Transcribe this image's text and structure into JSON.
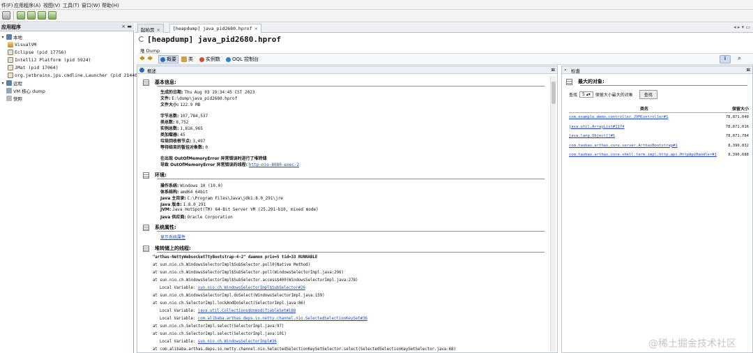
{
  "menu": {
    "items": [
      "件(F)",
      "应用程序(A)",
      "视图(V)",
      "工具(T)",
      "窗口(W)",
      "帮助(H)"
    ]
  },
  "left_panel": {
    "title": "应用程序",
    "controls": "× ▬",
    "tree": {
      "local": "本地",
      "apps": [
        "VisualVM",
        "Eclipse (pid 17756)",
        "IntelliJ Platform (pid 5924)",
        "JMat (pid 17064)",
        "org.jetbrains.jps.cmdline.Launcher (pid 21440)"
      ],
      "remote": "远程",
      "vm_dump": "VM 核心 dump",
      "snapshots": "快照"
    }
  },
  "tabs": {
    "start_page": "起始页",
    "heapdump": "[heapdump] java_pid2680.hprof",
    "right_controls": "◂ ▸ ▾ ▭"
  },
  "document": {
    "title": "[heapdump] java_pid2680.hprof",
    "subtab": "堆 Dump"
  },
  "navbar": {
    "summary": "概要",
    "classes": "类",
    "instances": "实例数",
    "oql": "OQL 控制台"
  },
  "overview": {
    "title": "概述",
    "basic_info": {
      "heading": "基本信息:",
      "created_label": "生成的日期:",
      "created_value": "Thu Aug 03 19:34:45 CST 2023",
      "file_label": "文件:",
      "file_value": "E:\\dump\\java_pid2680.hprof",
      "size_label": "文件大小:",
      "size_value": "122.9 MB",
      "bytes_label": "字节总数:",
      "bytes_value": "107,784,537",
      "classes_label": "类总数:",
      "classes_value": "8,752",
      "instances_label": "实例总数:",
      "instances_value": "1,816,965",
      "loaders_label": "类加载器:",
      "loaders_value": "45",
      "gcroots_label": "垃圾回收根节点:",
      "gcroots_value": "3,497",
      "finalize_label": "等待结束的暂挂对象数:",
      "finalize_value": "0",
      "oom_line": "在出现 OutOfMemoryError 异常错误时进行了堆转储",
      "oom_thread_label": "导致 OutOfMemoryError 异常错误的线程:",
      "oom_thread_link": "http-nio-8080-exec-2"
    },
    "environment": {
      "heading": "环境:",
      "os_label": "操作系统:",
      "os_value": "Windows 10 (10.0)",
      "arch_label": "体系结构:",
      "arch_value": "amd64 64bit",
      "home_label": "Java 主目录:",
      "home_value": "C:\\Program Files\\Java\\jdk1.8.0_291\\jre",
      "version_label": "Java 版本:",
      "version_value": "1.8.0_291",
      "jvm_label": "JVM:",
      "jvm_value": "Java HotSpot(TM) 64-Bit Server VM (25.291-b10, mixed mode)",
      "vendor_label": "Java 供应商:",
      "vendor_value": "Oracle Corporation"
    },
    "system_props": {
      "heading": "系统属性:",
      "link": "显示系统属性"
    },
    "threads": {
      "heading": "堆转储上的线程:",
      "lines": [
        {
          "t": "\"arthas-NettyWebsocketTtyBootstrap-4-2\" daemon prio=5 tid=33 RUNNABLE",
          "indent": 0,
          "link": false,
          "bold": true
        },
        {
          "t": "at sun.nio.ch.WindowsSelectorImpl$SubSelector.poll0(Native Method)",
          "indent": 1,
          "link": false
        },
        {
          "t": "at sun.nio.ch.WindowsSelectorImpl$SubSelector.poll(WindowsSelectorImpl.java:296)",
          "indent": 1,
          "link": false
        },
        {
          "t": "at sun.nio.ch.WindowsSelectorImpl$SubSelector.access$400(WindowsSelectorImpl.java:278)",
          "indent": 1,
          "link": false
        },
        {
          "t": "Local Variable: ",
          "indent": 2,
          "link": "sun.nio.ch.WindowsSelectorImpl$SubSelector#26"
        },
        {
          "t": "at sun.nio.ch.WindowsSelectorImpl.doSelect(WindowsSelectorImpl.java:159)",
          "indent": 1,
          "link": false
        },
        {
          "t": "at sun.nio.ch.SelectorImpl.lockAndDoSelect(SelectorImpl.java:86)",
          "indent": 1,
          "link": false
        },
        {
          "t": "Local Variable: ",
          "indent": 2,
          "link": "java.util.Collections$UnmodifiableSet#188"
        },
        {
          "t": "Local Variable: ",
          "indent": 2,
          "link": "com.alibaba.arthas.deps.io.netty.channel.nio.SelectedSelectionKeySet#36"
        },
        {
          "t": "at sun.nio.ch.SelectorImpl.select(SelectorImpl.java:97)",
          "indent": 1,
          "link": false
        },
        {
          "t": "at sun.nio.ch.SelectorImpl.select(SelectorImpl.java:101)",
          "indent": 1,
          "link": false
        },
        {
          "t": "Local Variable: ",
          "indent": 2,
          "link": "sun.nio.ch.WindowsSelectorImpl#36"
        },
        {
          "t": "at com.alibaba.arthas.deps.io.netty.channel.nio.SelectedSelectionKeySetSelector.select(SelectedSelectionKeySetSelector.java:68)",
          "indent": 1,
          "link": false
        }
      ]
    }
  },
  "right": {
    "title": "检查",
    "heading": "最大的对象:",
    "find_label": "查找",
    "find_count": "5",
    "find_suffix": "保留大小最大的对象",
    "find_button": "查找",
    "col_class": "类名",
    "col_size": "保留大小",
    "rows": [
      {
        "name": "com.example.demo.controller.JVMController#1",
        "size": "78,871,048"
      },
      {
        "name": "java.util.ArrayList#1174",
        "size": "78,871,016"
      },
      {
        "name": "java.lang.Object[]#1",
        "size": "78,871,784"
      },
      {
        "name": "com.taobao.arthas.core.server.ArthasBootstrap#1",
        "size": "8,390,832"
      },
      {
        "name": "com.taobao.arthas.core.shell.term.impl.http.api.HttpApiHandler#1",
        "size": "8,390,688"
      }
    ]
  },
  "watermark": "@稀土掘金技术社区",
  "colors": {
    "link": "#1a3fd6",
    "panel_header": "#eceff3",
    "border": "#b9c2cf"
  }
}
